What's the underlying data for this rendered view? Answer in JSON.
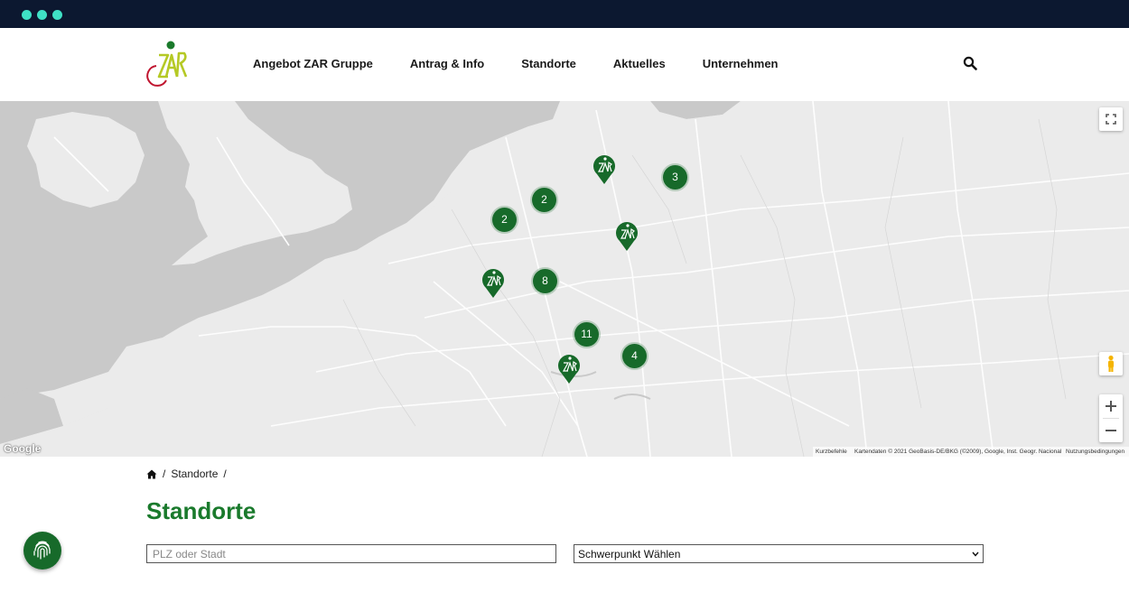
{
  "window": {
    "traffic_lights": [
      "#3fe0c5",
      "#3fe0c5",
      "#3fe0c5"
    ]
  },
  "header": {
    "logo_icon": "zar-logo-icon",
    "nav": [
      {
        "label": "Angebot ZAR Gruppe"
      },
      {
        "label": "Antrag & Info"
      },
      {
        "label": "Standorte"
      },
      {
        "label": "Aktuelles"
      },
      {
        "label": "Unternehmen"
      }
    ],
    "search_icon": "search-icon"
  },
  "map": {
    "clusters": [
      {
        "count": "3"
      },
      {
        "count": "2"
      },
      {
        "count": "2"
      },
      {
        "count": "8"
      },
      {
        "count": "11"
      },
      {
        "count": "4"
      }
    ],
    "single_markers": 4,
    "google_mark": "Google",
    "attribution": {
      "shortcuts": "Kurzbefehle",
      "data": "Kartendaten © 2021 GeoBasis-DE/BKG (©2009), Google, Inst. Geogr. Nacional",
      "terms": "Nutzungsbedingungen"
    },
    "controls": [
      "fullscreen-icon",
      "pegman-icon",
      "zoom-in-icon",
      "zoom-out-icon"
    ]
  },
  "breadcrumb": {
    "home_icon": "home-icon",
    "current": "Standorte",
    "separator": "/"
  },
  "page": {
    "title": "Standorte"
  },
  "filters": {
    "location_placeholder": "PLZ oder Stadt",
    "focus_selected": "Schwerpunkt Wählen"
  },
  "colors": {
    "brand_green": "#1a7a2c",
    "marker_green": "#176a2a",
    "chrome_bg": "#0c1830"
  },
  "floating": {
    "icon": "fingerprint-icon"
  }
}
